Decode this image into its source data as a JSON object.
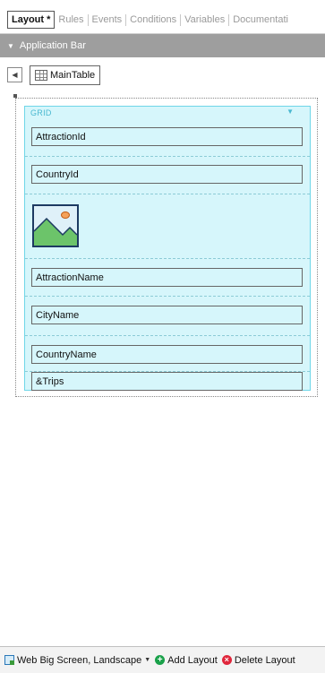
{
  "tabs": [
    {
      "label": "Layout *"
    },
    {
      "label": "Rules"
    },
    {
      "label": "Events"
    },
    {
      "label": "Conditions"
    },
    {
      "label": "Variables"
    },
    {
      "label": "Documentati"
    }
  ],
  "app_bar": {
    "label": "Application Bar",
    "icon": "caret-down-icon"
  },
  "main_table": {
    "label": "MainTable",
    "icon": "table-icon"
  },
  "grid": {
    "title": "GRID",
    "fields": [
      {
        "label": "AttractionId"
      },
      {
        "label": "CountryId"
      },
      {
        "label": "AttractionName"
      },
      {
        "label": "CityName"
      },
      {
        "label": "CountryName"
      },
      {
        "label": "&Trips"
      }
    ],
    "image_placeholder": "image-icon"
  },
  "status_bar": {
    "layout_label": "Web Big Screen, Landscape",
    "add_label": "Add Layout",
    "delete_label": "Delete Layout"
  },
  "colors": {
    "grid_bg": "#d6f6fb",
    "grid_border": "#6fd6e8",
    "app_bar_bg": "#9e9e9e"
  }
}
